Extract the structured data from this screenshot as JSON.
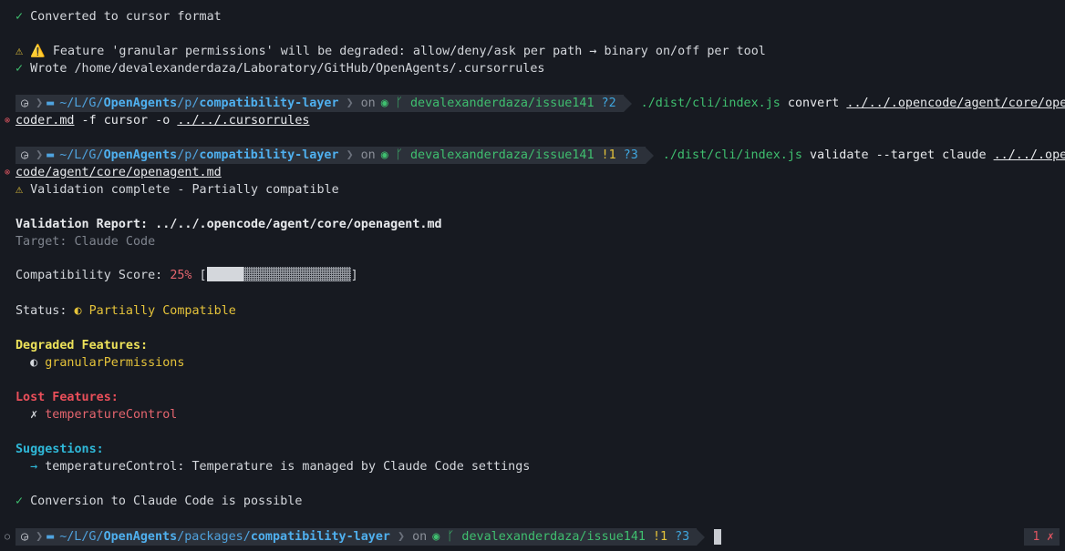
{
  "lines": {
    "l1_check": "✓",
    "l1_text": " Converted to cursor format",
    "l2_warn": "⚠",
    "l2_text": " ⚠️ Feature 'granular permissions' will be degraded: allow/deny/ask per path → binary on/off per tool",
    "l3_check": "✓",
    "l3_text": " Wrote /home/devalexanderdaza/Laboratory/GitHub/OpenAgents/.cursorrules"
  },
  "prompt1": {
    "path_prefix": "~/L/G/",
    "path_repo": "OpenAgents",
    "path_mid": "/p/",
    "path_leaf": "compatibility-layer",
    "on": "on",
    "branch": "devalexanderdaza/issue141",
    "untracked": "?2",
    "cmd": "./dist/cli/index.js",
    "args1": " convert ",
    "arg_path": "../../.opencode/agent/core/ope",
    "wrap_arg": "coder.md",
    "wrap_rest": " -f cursor -o ",
    "wrap_out": "../../.cursorrules"
  },
  "prompt2": {
    "path_prefix": "~/L/G/",
    "path_repo": "OpenAgents",
    "path_mid": "/p/",
    "path_leaf": "compatibility-layer",
    "on": "on",
    "branch": "devalexanderdaza/issue141",
    "dirty": "!1",
    "untracked": "?3",
    "cmd": "./dist/cli/index.js",
    "args1": " validate --target claude ",
    "arg_path": "../../.ope",
    "wrap_arg": "code/agent/core/openagent.md"
  },
  "report": {
    "complete_icon": "⚠",
    "complete_text": " Validation complete - Partially compatible",
    "title": "Validation Report: ../../.opencode/agent/core/openagent.md",
    "target": "Target: Claude Code",
    "score_label": "Compatibility Score: ",
    "score_value": "25%",
    "score_percent": 25,
    "bracket_open": " [",
    "bracket_close": "]",
    "status_label": "Status: ",
    "status_icon": "◐",
    "status_value": " Partially Compatible",
    "degraded_heading": "Degraded Features:",
    "degraded_icon": "◐",
    "degraded_item": " granularPermissions",
    "lost_heading": "Lost Features:",
    "lost_icon": "✗",
    "lost_item": " temperatureControl",
    "suggestions_heading": "Suggestions:",
    "suggestion_arrow": "→",
    "suggestion_text": " temperatureControl: Temperature is managed by Claude Code settings",
    "final_check": "✓",
    "final_text": " Conversion to Claude Code is possible"
  },
  "prompt3": {
    "path_prefix": "~/L/G/",
    "path_repo": "OpenAgents",
    "path_mid": "/packages/",
    "path_leaf": "compatibility-layer",
    "on": "on",
    "branch": "devalexanderdaza/issue141",
    "dirty": "!1",
    "untracked": "?3"
  },
  "error_badge": {
    "count": "1",
    "icon": "✗"
  },
  "gutter": {
    "error_mark": "⊗",
    "idle_mark": "○"
  },
  "colors": {
    "background": "#171a21",
    "success": "#3fbf6f",
    "warning": "#e5c33a",
    "error": "#e05561",
    "path": "#4fb0ef"
  }
}
